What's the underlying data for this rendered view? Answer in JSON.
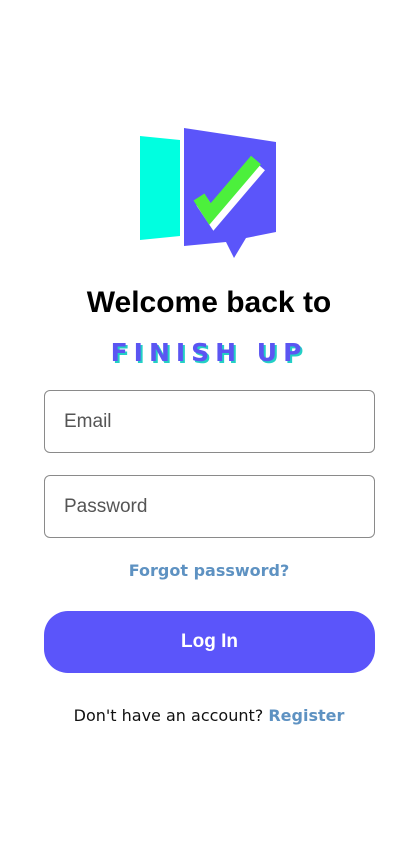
{
  "header": {
    "welcome_text": "Welcome back to",
    "brand_name": "FINISH UP"
  },
  "form": {
    "email_placeholder": "Email",
    "password_placeholder": "Password",
    "forgot_label": "Forgot password?",
    "login_label": "Log In"
  },
  "footer": {
    "prompt": "Don't have an account?",
    "register_label": "Register"
  },
  "colors": {
    "accent": "#5b55fa",
    "link": "#5e92c2",
    "logo_cyan": "#00ffe0",
    "logo_purple": "#5b55fa",
    "check_green": "#4cf03c"
  },
  "icons": {
    "logo": "finish-up-logo-icon"
  }
}
